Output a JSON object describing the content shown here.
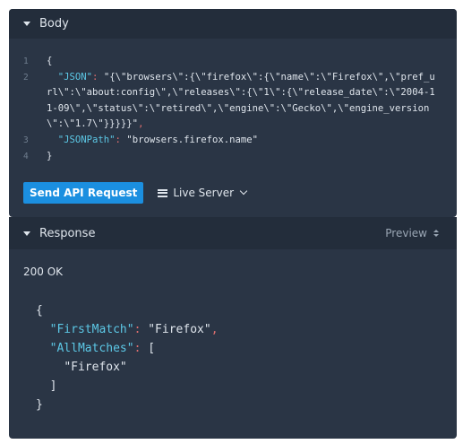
{
  "body_panel": {
    "title": "Body",
    "line_numbers": [
      "1",
      "2",
      "3",
      "4"
    ],
    "lines": {
      "open": "{",
      "json_key": "\"JSON\"",
      "json_value": "\"{\\\"browsers\\\":{\\\"firefox\\\":{\\\"name\\\":\\\"Firefox\\\",\\\"pref_url\\\":\\\"about:config\\\",\\\"releases\\\":{\\\"1\\\":{\\\"release_date\\\":\\\"2004-11-09\\\",\\\"status\\\":\\\"retired\\\",\\\"engine\\\":\\\"Gecko\\\",\\\"engine_version\\\":\\\"1.7\\\"}}}}}\"",
      "jsonpath_key": "\"JSONPath\"",
      "jsonpath_value": "\"browsers.firefox.name\"",
      "close": "}"
    },
    "send_button": "Send API Request",
    "server_label": "Live Server"
  },
  "response_panel": {
    "title": "Response",
    "preview_label": "Preview",
    "status": "200 OK",
    "json": {
      "open": "{",
      "first_match_key": "\"FirstMatch\"",
      "first_match_value": "\"Firefox\"",
      "all_matches_key": "\"AllMatches\"",
      "array_open": "[",
      "array_item": "\"Firefox\"",
      "array_close": "]",
      "close": "}"
    }
  }
}
